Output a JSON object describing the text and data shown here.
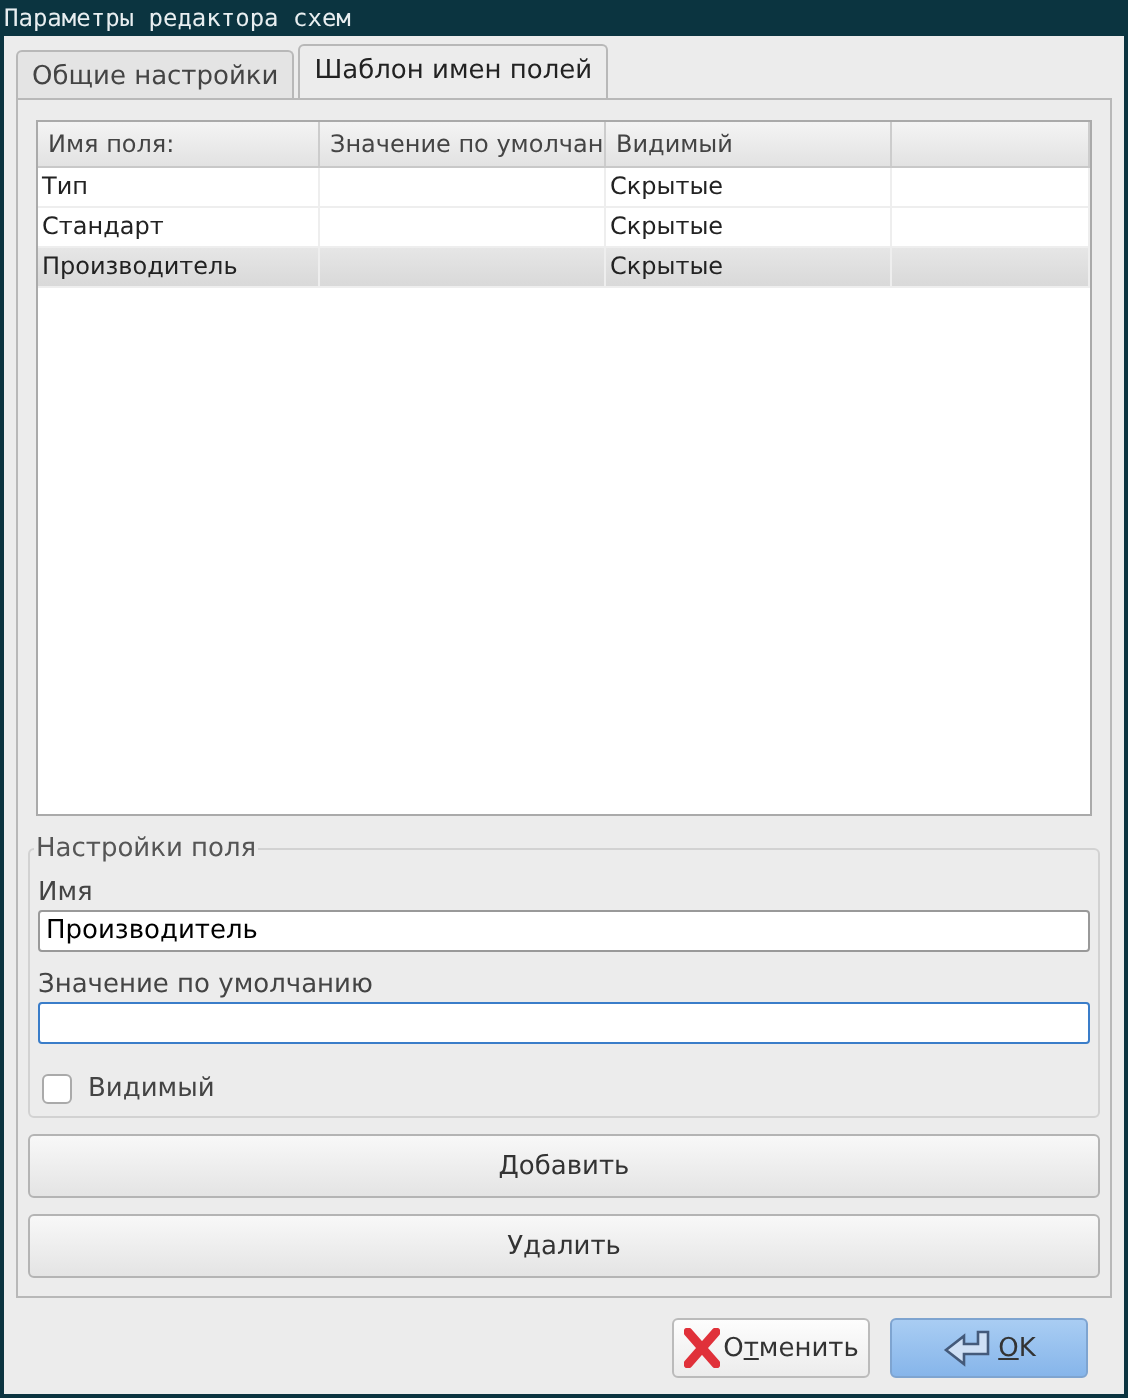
{
  "window": {
    "title": "Параметры редактора схем"
  },
  "tabs": [
    {
      "label": "Общие настройки",
      "selected": false
    },
    {
      "label": "Шаблон имен полей",
      "selected": true
    }
  ],
  "table": {
    "columns": [
      "Имя поля:",
      "Значение по умолчан",
      "Видимый"
    ],
    "rows": [
      {
        "cells": [
          "Тип",
          "",
          "Скрытые"
        ],
        "selected": false
      },
      {
        "cells": [
          "Стандарт",
          "",
          "Скрытые"
        ],
        "selected": false
      },
      {
        "cells": [
          "Производитель",
          "",
          "Скрытые"
        ],
        "selected": true
      }
    ]
  },
  "field_settings": {
    "title": "Настройки поля",
    "name_label": "Имя",
    "name_value": "Производитель",
    "default_label": "Значение по умолчанию",
    "visible": {
      "label": "Видимый",
      "checked": false
    }
  },
  "actions": [
    "Добавить",
    "Удалить"
  ],
  "dialog_buttons": [
    {
      "kind": "cancel",
      "label_start": "О",
      "mnemonic": "т",
      "label_end": "менить"
    },
    {
      "kind": "ok",
      "mnemonic": "O",
      "label_end": "K"
    }
  ]
}
